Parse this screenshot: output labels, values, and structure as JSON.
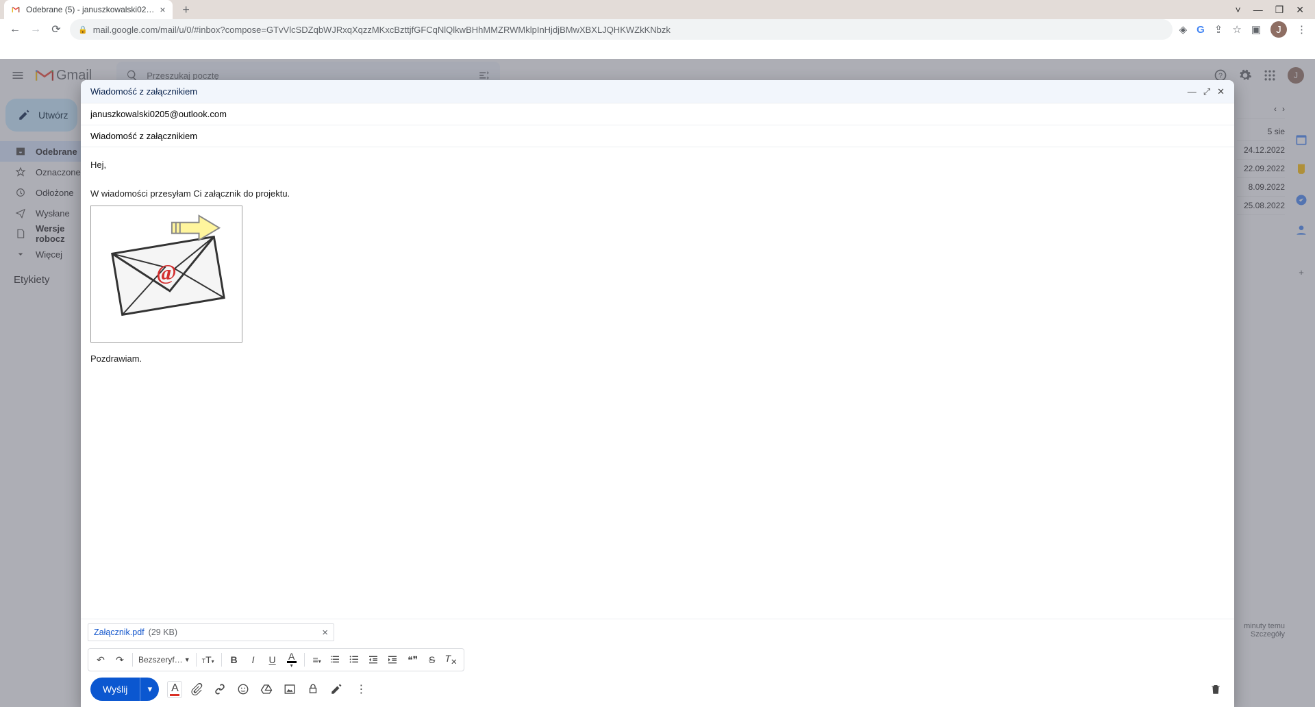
{
  "browser": {
    "tab_title": "Odebrane (5) - januszkowalski02…",
    "url": "mail.google.com/mail/u/0/#inbox?compose=GTvVlcSDZqbWJRxqXqzzMKxcBzttjfGFCqNlQlkwBHhMMZRWMklpInHjdjBMwXBXLJQHKWZkKNbzk",
    "avatar_letter": "J"
  },
  "gmail": {
    "logo_text": "Gmail",
    "search_placeholder": "Przeszukaj pocztę",
    "compose_label": "Utwórz",
    "nav": [
      {
        "icon": "inbox",
        "label": "Odebrane",
        "active": true,
        "bold": true
      },
      {
        "icon": "star",
        "label": "Oznaczone gw"
      },
      {
        "icon": "clock",
        "label": "Odłożone"
      },
      {
        "icon": "send",
        "label": "Wysłane"
      },
      {
        "icon": "draft",
        "label": "Wersje robocz",
        "bold": true
      },
      {
        "icon": "more",
        "label": "Więcej"
      }
    ],
    "labels_title": "Etykiety",
    "inbox_peek": {
      "header_date": "5 sie",
      "dates": [
        "24.12.2022",
        "22.09.2022",
        "8.09.2022",
        "25.08.2022"
      ]
    },
    "activity": {
      "line1": "minuty temu",
      "line2": "Szczegóły"
    }
  },
  "compose": {
    "title": "Wiadomość z załącznikiem",
    "to": "januszkowalski0205@outlook.com",
    "subject": "Wiadomość z załącznikiem",
    "body_lines": [
      "Hej,",
      "",
      "W wiadomości przesyłam Ci załącznik do projektu.",
      "[IMAGE]",
      "Pozdrawiam."
    ],
    "attachment": {
      "name": "Załącznik.pdf",
      "size": "(29 KB)"
    },
    "toolbar": {
      "font_label": "Bezszeryf…",
      "send_label": "Wyślij"
    }
  }
}
